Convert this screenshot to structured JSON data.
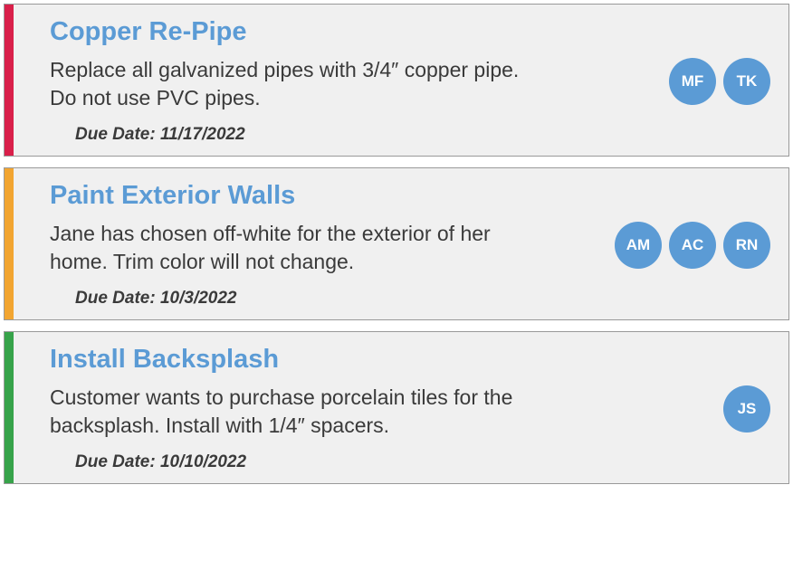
{
  "tasks": [
    {
      "stripeClass": "stripe-red",
      "title": "Copper Re-Pipe",
      "description": "Replace all galvanized pipes with 3/4″ copper pipe. Do not use PVC pipes.",
      "dueLabel": "Due Date: 11/17/2022",
      "assignees": [
        "MF",
        "TK"
      ]
    },
    {
      "stripeClass": "stripe-orange",
      "title": "Paint Exterior Walls",
      "description": "Jane has chosen off-white for the exterior of her home. Trim color will not change.",
      "dueLabel": "Due Date: 10/3/2022",
      "assignees": [
        "AM",
        "AC",
        "RN"
      ]
    },
    {
      "stripeClass": "stripe-green",
      "title": "Install Backsplash",
      "description": "Customer wants to purchase porcelain tiles for the backsplash. Install with 1/4″ spacers.",
      "dueLabel": "Due Date: 10/10/2022",
      "assignees": [
        "JS"
      ]
    }
  ]
}
